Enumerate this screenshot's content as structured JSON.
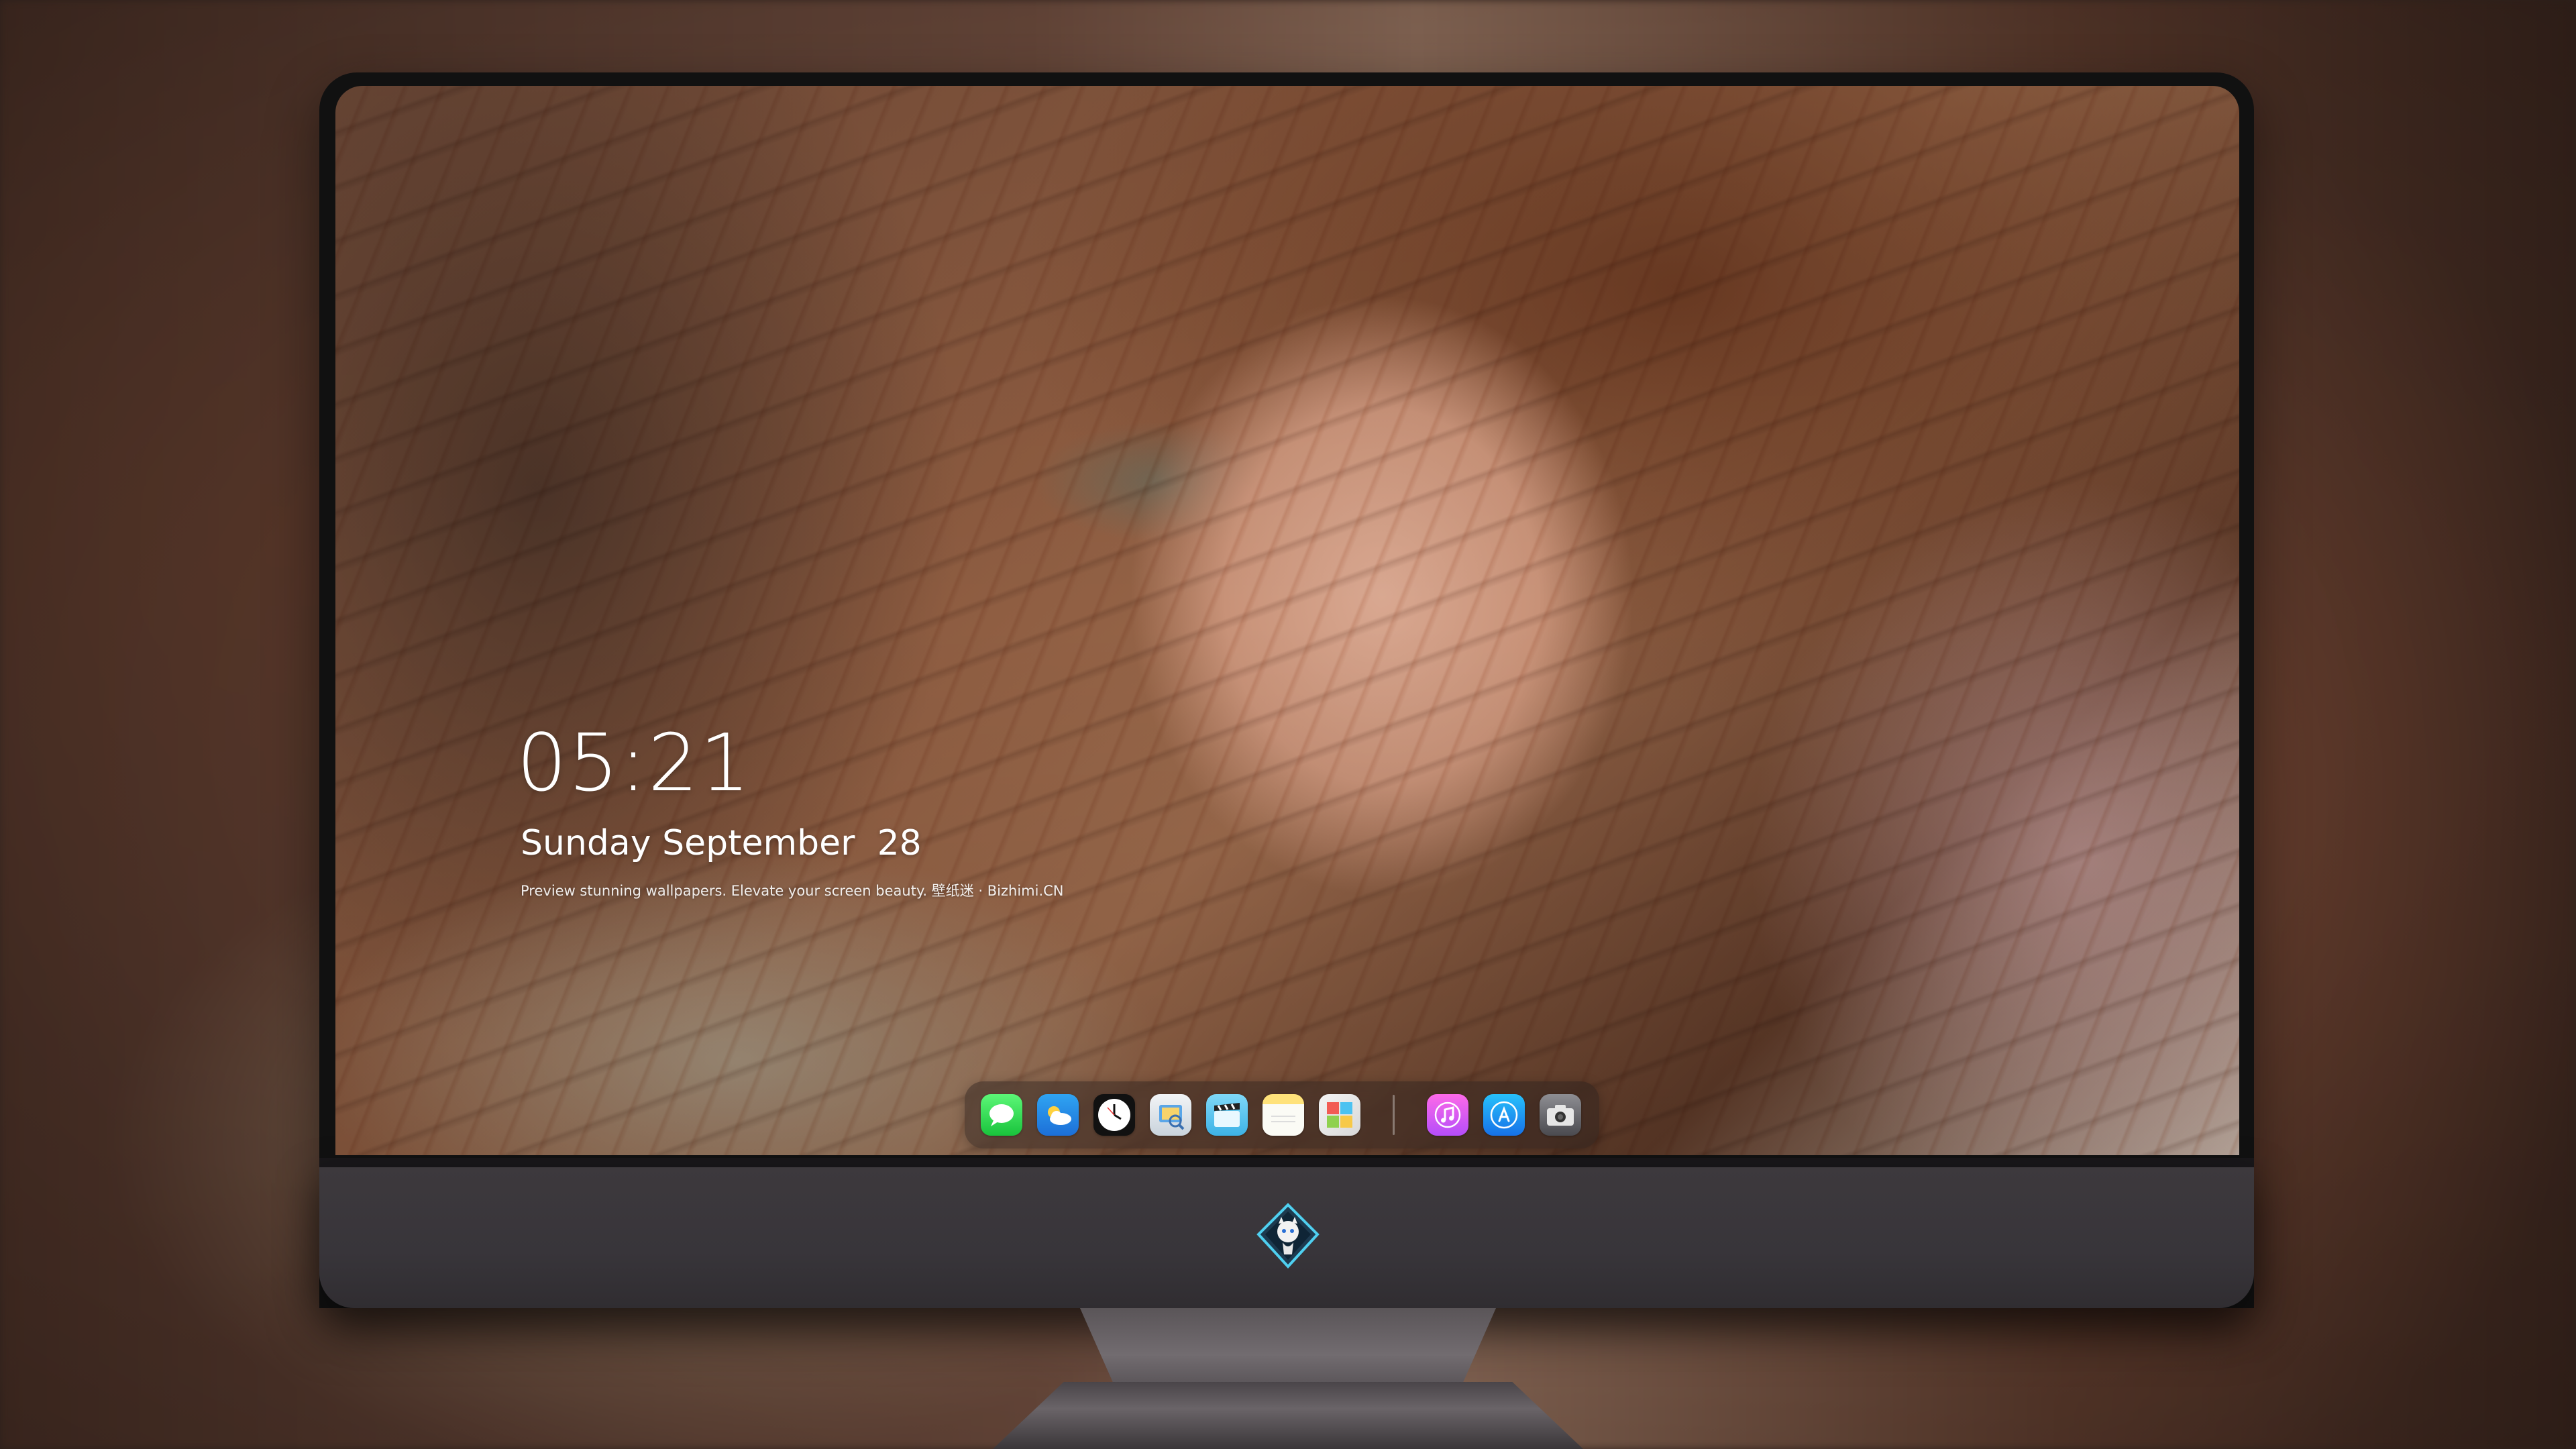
{
  "lockscreen": {
    "time": "05:21",
    "date": "Sunday September  28",
    "tagline": "Preview stunning wallpapers. Elevate your screen beauty. 壁纸迷 · Bizhimi.CN"
  },
  "dock": {
    "apps": [
      {
        "name": "Messages",
        "icon": "messages-icon"
      },
      {
        "name": "Weather",
        "icon": "weather-icon"
      },
      {
        "name": "Clock",
        "icon": "clock-icon"
      },
      {
        "name": "Preview",
        "icon": "preview-icon"
      },
      {
        "name": "Claquette",
        "icon": "clapperboard-icon"
      },
      {
        "name": "Notes",
        "icon": "notes-icon"
      },
      {
        "name": "Photo Booth",
        "icon": "photo-grid-icon"
      },
      {
        "name": "iTunes",
        "icon": "music-note-icon"
      },
      {
        "name": "App Store",
        "icon": "app-store-icon"
      },
      {
        "name": "Camera",
        "icon": "camera-icon"
      }
    ]
  },
  "colors": {
    "monitor_chin": "#3a363b",
    "bezel": "#111111",
    "text": "#ffffff"
  }
}
